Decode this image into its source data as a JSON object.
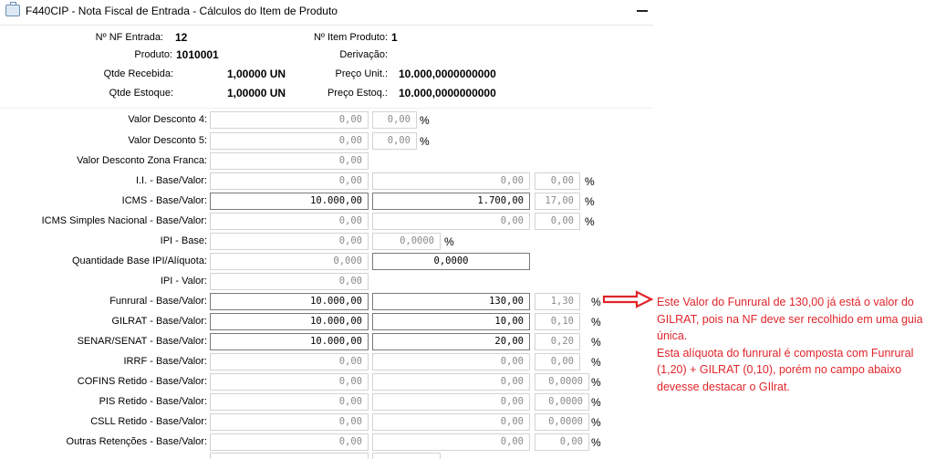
{
  "window": {
    "title": "F440CIP - Nota Fiscal de Entrada - Cálculos do Item de Produto",
    "icon": "briefcase-icon"
  },
  "header": {
    "nf_entrada_label": "Nº NF Entrada:",
    "nf_entrada_value": "12",
    "item_produto_label": "Nº Item Produto:",
    "item_produto_value": "1",
    "produto_label": "Produto:",
    "produto_value": "1010001",
    "derivacao_label": "Derivação:",
    "qtde_recebida_label": "Qtde Recebida:",
    "qtde_recebida_value": "1,00000 UN",
    "preco_unit_label": "Preço Unit.:",
    "preco_unit_value": "10.000,0000000000",
    "qtde_estoque_label": "Qtde Estoque:",
    "qtde_estoque_value": "1,00000 UN",
    "preco_estoq_label": "Preço Estoq.:",
    "preco_estoq_value": "10.000,0000000000"
  },
  "rows": {
    "desconto4": {
      "label": "Valor Desconto 4:",
      "v1": "0,00",
      "v2": "0,00",
      "pct": "%"
    },
    "desconto5": {
      "label": "Valor Desconto 5:",
      "v1": "0,00",
      "v2": "0,00",
      "pct": "%"
    },
    "zona_franca": {
      "label": "Valor Desconto Zona Franca:",
      "v1": "0,00"
    },
    "ii": {
      "label": "I.I. - Base/Valor:",
      "v1": "0,00",
      "v2": "0,00",
      "v3": "0,00",
      "pct": "%"
    },
    "icms": {
      "label": "ICMS - Base/Valor:",
      "v1": "10.000,00",
      "v2": "1.700,00",
      "v3": "17,00",
      "pct": "%"
    },
    "icms_simples": {
      "label": "ICMS Simples Nacional - Base/Valor:",
      "v1": "0,00",
      "v2": "0,00",
      "v3": "0,00",
      "pct": "%"
    },
    "ipi_base": {
      "label": "IPI - Base:",
      "v1": "0,00",
      "v2": "0,0000",
      "pct": "%"
    },
    "qtd_base_ipi": {
      "label": "Quantidade Base IPI/Alíquota:",
      "v1": "0,000",
      "v2": "0,0000"
    },
    "ipi_valor": {
      "label": "IPI - Valor:",
      "v1": "0,00"
    },
    "funrural": {
      "label": "Funrural - Base/Valor:",
      "v1": "10.000,00",
      "v2": "130,00",
      "v3": "1,30",
      "pct": "%"
    },
    "gilrat": {
      "label": "GILRAT - Base/Valor:",
      "v1": "10.000,00",
      "v2": "10,00",
      "v3": "0,10",
      "pct": "%"
    },
    "senar": {
      "label": "SENAR/SENAT - Base/Valor:",
      "v1": "10.000,00",
      "v2": "20,00",
      "v3": "0,20",
      "pct": "%"
    },
    "irrf": {
      "label": "IRRF - Base/Valor:",
      "v1": "0,00",
      "v2": "0,00",
      "v3": "0,00",
      "pct": "%"
    },
    "cofins": {
      "label": "COFINS Retido - Base/Valor:",
      "v1": "0,00",
      "v2": "0,00",
      "v3": "0,0000",
      "pct": "%"
    },
    "pis": {
      "label": "PIS Retido - Base/Valor:",
      "v1": "0,00",
      "v2": "0,00",
      "v3": "0,0000",
      "pct": "%"
    },
    "csll": {
      "label": "CSLL Retido - Base/Valor:",
      "v1": "0,00",
      "v2": "0,00",
      "v3": "0,0000",
      "pct": "%"
    },
    "outras": {
      "label": "Outras Retenções - Base/Valor:",
      "v1": "0,00",
      "v2": "0,00",
      "v3": "0,00",
      "pct": "%"
    }
  },
  "annotation": {
    "line1": "Este Valor do Funrural de 130,00 já está o valor do GILRAT, pois na NF deve ser recolhido em uma guia única.",
    "line2": "Esta alíquota do funrural é composta com Funrural (1,20) + GILRAT (0,10), porém no campo abaixo devesse destacar o GIlrat.",
    "color": "#e0252a"
  }
}
